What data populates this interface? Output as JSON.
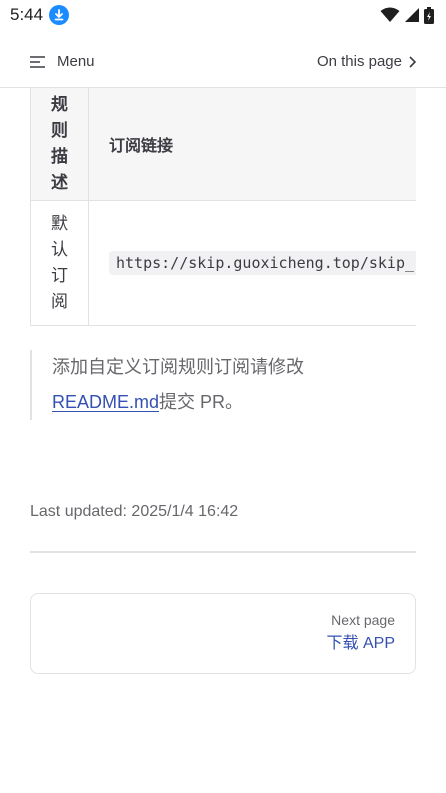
{
  "status_bar": {
    "time": "5:44"
  },
  "nav": {
    "menu_label": "Menu",
    "on_this_page_label": "On this page"
  },
  "table": {
    "headers": [
      "规则描述",
      "订阅链接"
    ],
    "rows": [
      {
        "description": "默认订阅",
        "link": "https://skip.guoxicheng.top/skip_"
      }
    ]
  },
  "tip": {
    "prefix": "添加自定义订阅规则订阅请修改",
    "link_text": "README.md",
    "suffix": "提交 PR。"
  },
  "footer": {
    "last_updated_label": "Last updated:",
    "last_updated_value": "2025/1/4 16:42",
    "next_page_label": "Next page",
    "next_page_title": "下载 APP"
  },
  "colors": {
    "link": "#3451b2",
    "download_badge": "#1a8cff",
    "border": "#e2e2e3"
  }
}
